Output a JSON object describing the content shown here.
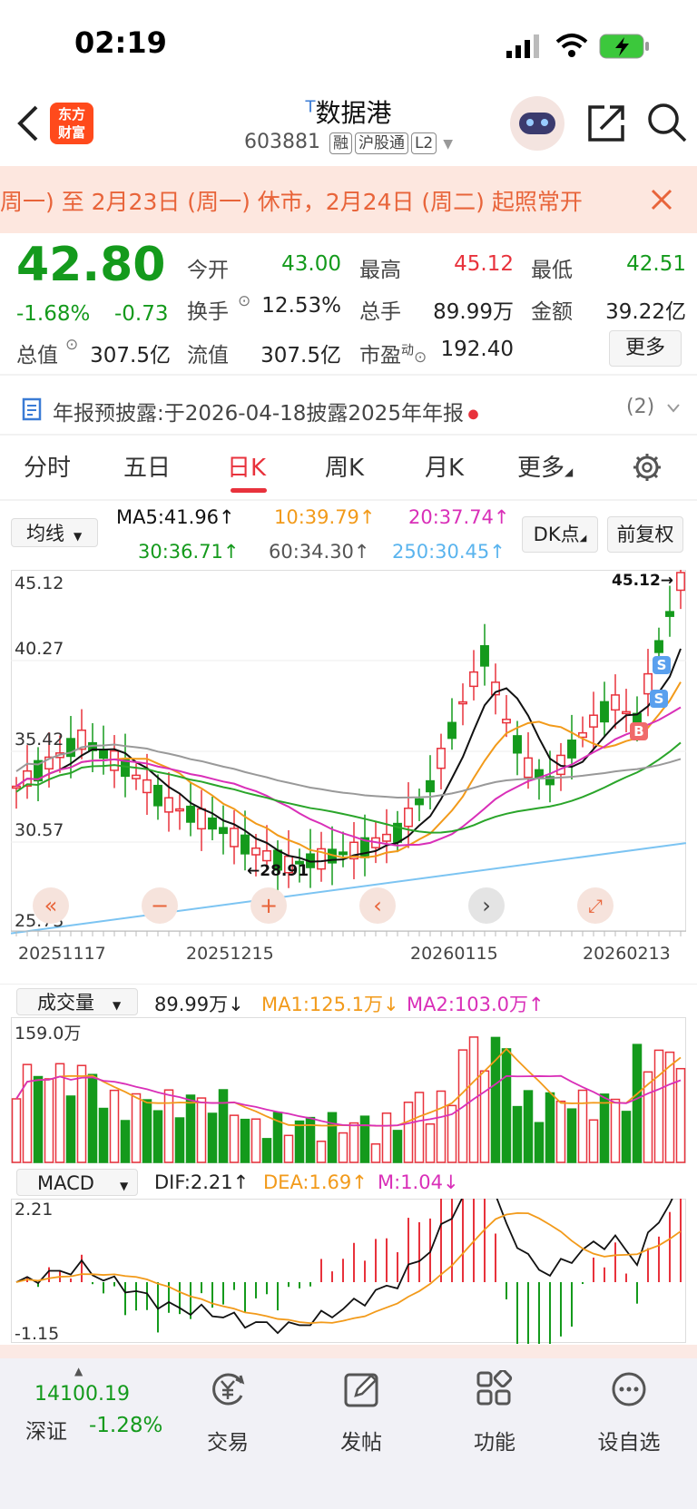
{
  "status_bar": {
    "time": "02:19"
  },
  "header": {
    "logo_text_1": "东方",
    "logo_text_2": "财富",
    "stock_flag": "T",
    "stock_name": "数据港",
    "stock_code": "603881",
    "tags": [
      "融",
      "沪股通",
      "L2"
    ]
  },
  "notice": {
    "text": "周一) 至 2月23日 (周一) 休市，2月24日 (周二) 起照常开"
  },
  "quote": {
    "price": "42.80",
    "change_pct": "-1.68%",
    "change": "-0.73",
    "open_label": "今开",
    "open": "43.00",
    "high_label": "最高",
    "high": "45.12",
    "low_label": "最低",
    "low": "42.51",
    "turnover_label": "换手",
    "turnover": "12.53%",
    "volume_label": "总手",
    "volume": "89.99万",
    "amount_label": "金额",
    "amount": "39.22亿",
    "mktcap_label": "总值",
    "mktcap": "307.5亿",
    "float_label": "流值",
    "float": "307.5亿",
    "pe_label": "市盈",
    "pe_sup": "动",
    "pe": "192.40",
    "more": "更多"
  },
  "announcement": {
    "label": "年报预披露:",
    "text": "于2026-04-18披露2025年年报",
    "count": "(2)"
  },
  "tabs": [
    "分时",
    "五日",
    "日K",
    "周K",
    "月K",
    "更多"
  ],
  "active_tab": "日K",
  "indicator_row": {
    "selector": "均线",
    "ma5": "MA5:41.96↑",
    "ma10": "10:39.79↑",
    "ma20": "20:37.74↑",
    "ma30": "30:36.71↑",
    "ma60": "60:34.30↑",
    "ma250": "250:30.45↑",
    "dk": "DK点",
    "adjust": "前复权"
  },
  "kline": {
    "y_labels": [
      "45.12",
      "40.27",
      "35.42",
      "30.57",
      "25.73"
    ],
    "max_marker": "45.12→",
    "min_marker": "←28.91",
    "x_labels": [
      "20251117",
      "20251215",
      "20260115",
      "20260213"
    ],
    "signals": [
      "S",
      "S",
      "B"
    ],
    "colors": {
      "up": "#e8323c",
      "down": "#149a1c",
      "ma5": "#111111",
      "ma10": "#f29a1a",
      "ma20": "#d92fb8",
      "ma30": "#2aa52a",
      "ma60": "#999999",
      "ma250": "#7cc4f2"
    }
  },
  "volume": {
    "selector": "成交量",
    "value": "89.99万↓",
    "ma1": "MA1:125.1万↓",
    "ma2": "MA2:103.0万↑",
    "y_max": "159.0万"
  },
  "macd": {
    "selector": "MACD",
    "dif": "DIF:2.21↑",
    "dea": "DEA:1.69↑",
    "m": "M:1.04↓",
    "y_max": "2.21",
    "y_min": "-1.15"
  },
  "bottom_nav": {
    "index_value": "14100.19",
    "index_name": "深证",
    "index_change": "-1.28%",
    "items": [
      "交易",
      "发帖",
      "功能",
      "设自选"
    ]
  }
}
